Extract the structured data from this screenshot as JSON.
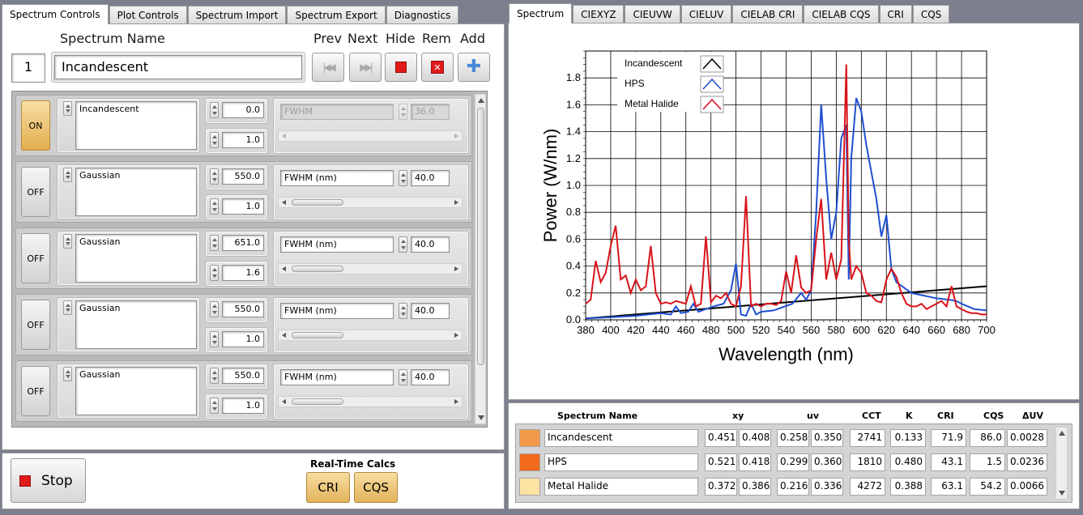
{
  "left_tabs": [
    "Spectrum Controls",
    "Plot Controls",
    "Spectrum Import",
    "Spectrum Export",
    "Diagnostics"
  ],
  "right_tabs": [
    "Spectrum",
    "CIEXYZ",
    "CIEUVW",
    "CIELUV",
    "CIELAB CRI",
    "CIELAB CQS",
    "CRI",
    "CQS"
  ],
  "controls": {
    "spectrum_name_label": "Spectrum Name",
    "prev_label": "Prev",
    "next_label": "Next",
    "hide_label": "Hide",
    "rem_label": "Rem",
    "add_label": "Add",
    "index": "1",
    "spectrum_name": "Incandescent"
  },
  "rows": [
    {
      "state": "ON",
      "type": "Incandescent",
      "center": "0.0",
      "scale": "1.0",
      "width_label": "FWHM",
      "width": "36.0",
      "disabled": true
    },
    {
      "state": "OFF",
      "type": "Gaussian",
      "center": "550.0",
      "scale": "1.0",
      "width_label": "FWHM (nm)",
      "width": "40.0",
      "disabled": false
    },
    {
      "state": "OFF",
      "type": "Gaussian",
      "center": "651.0",
      "scale": "1.6",
      "width_label": "FWHM (nm)",
      "width": "40.0",
      "disabled": false
    },
    {
      "state": "OFF",
      "type": "Gaussian",
      "center": "550.0",
      "scale": "1.0",
      "width_label": "FWHM (nm)",
      "width": "40.0",
      "disabled": false
    },
    {
      "state": "OFF",
      "type": "Gaussian",
      "center": "550.0",
      "scale": "1.0",
      "width_label": "FWHM (nm)",
      "width": "40.0",
      "disabled": false
    }
  ],
  "bottom": {
    "stop_label": "Stop",
    "realtime_label": "Real-Time Calcs",
    "cri_button": "CRI",
    "cqs_button": "CQS"
  },
  "table": {
    "headers": {
      "name": "Spectrum Name",
      "xy": "xy",
      "uv": "uv",
      "cct": "CCT",
      "k": "K",
      "cri": "CRI",
      "cqs": "CQS",
      "duv": "ΔUV"
    },
    "rows": [
      {
        "color": "#f39a4a",
        "name": "Incandescent",
        "x": "0.451",
        "y": "0.408",
        "u": "0.258",
        "v": "0.350",
        "cct": "2741",
        "k": "0.133",
        "cri": "71.9",
        "cqs": "86.0",
        "duv": "0.0028"
      },
      {
        "color": "#f26a1b",
        "name": "HPS",
        "x": "0.521",
        "y": "0.418",
        "u": "0.299",
        "v": "0.360",
        "cct": "1810",
        "k": "0.480",
        "cri": "43.1",
        "cqs": "1.5",
        "duv": "0.0236"
      },
      {
        "color": "#fde3a2",
        "name": "Metal Halide",
        "x": "0.372",
        "y": "0.386",
        "u": "0.216",
        "v": "0.336",
        "cct": "4272",
        "k": "0.388",
        "cri": "63.1",
        "cqs": "54.2",
        "duv": "0.0066"
      }
    ]
  },
  "chart_data": {
    "type": "line",
    "xlabel": "Wavelength (nm)",
    "ylabel": "Power (W/nm)",
    "xlim": [
      380,
      700
    ],
    "ylim": [
      0,
      2.0
    ],
    "xticks": [
      380,
      400,
      420,
      440,
      460,
      480,
      500,
      520,
      540,
      560,
      580,
      600,
      620,
      640,
      660,
      680,
      700
    ],
    "yticks": [
      0.0,
      0.2,
      0.4,
      0.6,
      0.8,
      1.0,
      1.2,
      1.4,
      1.6,
      1.8
    ],
    "ytick_labels": [
      "0.0",
      "0.2",
      "0.4",
      "0.6",
      "0.8",
      "1.0",
      "1.2",
      "1.4",
      "1.6",
      "1.8"
    ],
    "grid": true,
    "legend_position": "top-left",
    "series": [
      {
        "name": "Incandescent",
        "color": "#000000",
        "x": [
          380,
          700
        ],
        "y": [
          0.01,
          0.25
        ]
      },
      {
        "name": "HPS",
        "color": "#1f4fd1",
        "x": [
          380,
          400,
          420,
          440,
          448,
          452,
          456,
          462,
          466,
          470,
          476,
          482,
          490,
          496,
          500,
          504,
          508,
          512,
          516,
          520,
          530,
          545,
          552,
          556,
          560,
          564,
          568,
          572,
          576,
          580,
          584,
          588,
          590,
          592,
          596,
          600,
          604,
          608,
          612,
          616,
          620,
          624,
          628,
          634,
          640,
          650,
          660,
          670,
          676,
          680,
          690,
          700
        ],
        "y": [
          0.01,
          0.02,
          0.03,
          0.05,
          0.04,
          0.1,
          0.05,
          0.06,
          0.12,
          0.06,
          0.08,
          0.1,
          0.12,
          0.22,
          0.42,
          0.04,
          0.03,
          0.12,
          0.04,
          0.06,
          0.07,
          0.12,
          0.2,
          0.15,
          0.22,
          0.8,
          1.6,
          1.05,
          0.6,
          0.8,
          1.35,
          1.45,
          0.3,
          1.2,
          1.65,
          1.55,
          1.3,
          1.1,
          0.9,
          0.62,
          0.78,
          0.38,
          0.28,
          0.24,
          0.2,
          0.18,
          0.16,
          0.15,
          0.14,
          0.12,
          0.08,
          0.07
        ]
      },
      {
        "name": "Metal Halide",
        "color": "#d9131a",
        "x": [
          380,
          384,
          388,
          392,
          396,
          400,
          404,
          408,
          412,
          416,
          420,
          424,
          428,
          432,
          436,
          440,
          444,
          448,
          452,
          456,
          460,
          464,
          468,
          472,
          476,
          480,
          484,
          488,
          492,
          496,
          500,
          504,
          508,
          512,
          516,
          520,
          524,
          528,
          532,
          536,
          540,
          544,
          548,
          552,
          556,
          560,
          564,
          568,
          572,
          576,
          580,
          584,
          588,
          590,
          592,
          596,
          600,
          604,
          608,
          612,
          616,
          620,
          624,
          628,
          632,
          636,
          640,
          644,
          648,
          652,
          656,
          660,
          664,
          668,
          672,
          676,
          680,
          684,
          688,
          692,
          696,
          700
        ],
        "y": [
          0.12,
          0.15,
          0.44,
          0.28,
          0.35,
          0.55,
          0.7,
          0.3,
          0.33,
          0.2,
          0.3,
          0.22,
          0.25,
          0.55,
          0.2,
          0.12,
          0.13,
          0.12,
          0.14,
          0.13,
          0.12,
          0.25,
          0.1,
          0.12,
          0.62,
          0.13,
          0.18,
          0.16,
          0.2,
          0.12,
          0.1,
          0.25,
          0.92,
          0.1,
          0.12,
          0.1,
          0.12,
          0.12,
          0.11,
          0.14,
          0.36,
          0.2,
          0.48,
          0.24,
          0.2,
          0.22,
          0.6,
          0.9,
          0.3,
          0.5,
          0.3,
          0.45,
          1.9,
          0.6,
          0.3,
          0.4,
          0.35,
          0.2,
          0.18,
          0.14,
          0.13,
          0.3,
          0.38,
          0.32,
          0.2,
          0.12,
          0.1,
          0.1,
          0.12,
          0.08,
          0.1,
          0.12,
          0.14,
          0.1,
          0.25,
          0.1,
          0.08,
          0.06,
          0.05,
          0.05,
          0.04,
          0.04
        ]
      }
    ]
  }
}
